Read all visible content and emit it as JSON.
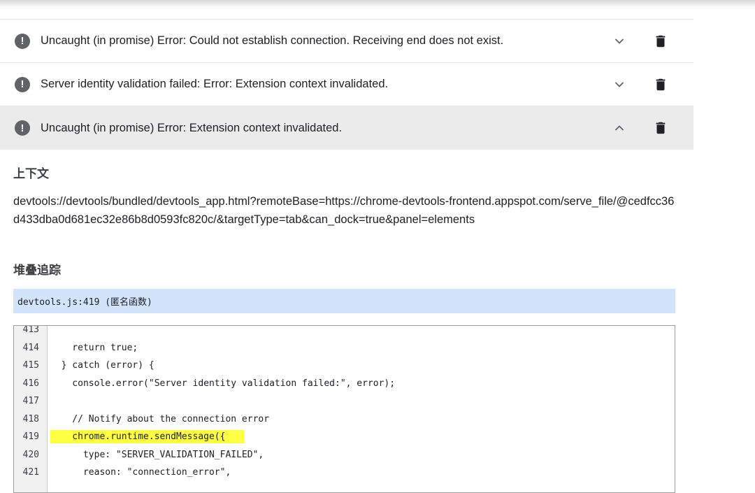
{
  "errors": [
    {
      "message": "Uncaught (in promise) Error: Could not establish connection. Receiving end does not exist.",
      "icon": "error-exclamation-icon",
      "expanded": false
    },
    {
      "message": "Server identity validation failed: Error: Extension context invalidated.",
      "icon": "error-exclamation-icon",
      "expanded": false
    },
    {
      "message": "Uncaught (in promise) Error: Extension context invalidated.",
      "icon": "error-exclamation-icon",
      "expanded": true
    }
  ],
  "error_icon_glyph": "!",
  "context": {
    "title": "上下文",
    "url": "devtools://devtools/bundled/devtools_app.html?remoteBase=https://chrome-devtools-frontend.appspot.com/serve_file/@cedfcc36d433dba0d681ec32e86b8d0593fc820c/&targetType=tab&can_dock=true&panel=elements"
  },
  "stack_trace": {
    "title": "堆叠追踪",
    "frame": "devtools.js:419 (匿名函数)"
  },
  "code": {
    "highlight_line": 419,
    "lines": [
      {
        "n": "413",
        "text": ""
      },
      {
        "n": "414",
        "text": "    return true;"
      },
      {
        "n": "415",
        "text": "  } catch (error) {"
      },
      {
        "n": "416",
        "text": "    console.error(\"Server identity validation failed:\", error);"
      },
      {
        "n": "417",
        "text": ""
      },
      {
        "n": "418",
        "text": "    // Notify about the connection error"
      },
      {
        "n": "419",
        "text": "    chrome.runtime.sendMessage({"
      },
      {
        "n": "420",
        "text": "      type: \"SERVER_VALIDATION_FAILED\","
      },
      {
        "n": "421",
        "text": "      reason: \"connection_error\","
      }
    ]
  },
  "colors": {
    "frame_bg": "#d2e3fc",
    "highlight": "#ffff44",
    "active_row_bg": "#ebebeb",
    "icon_gray": "#5f6368"
  }
}
